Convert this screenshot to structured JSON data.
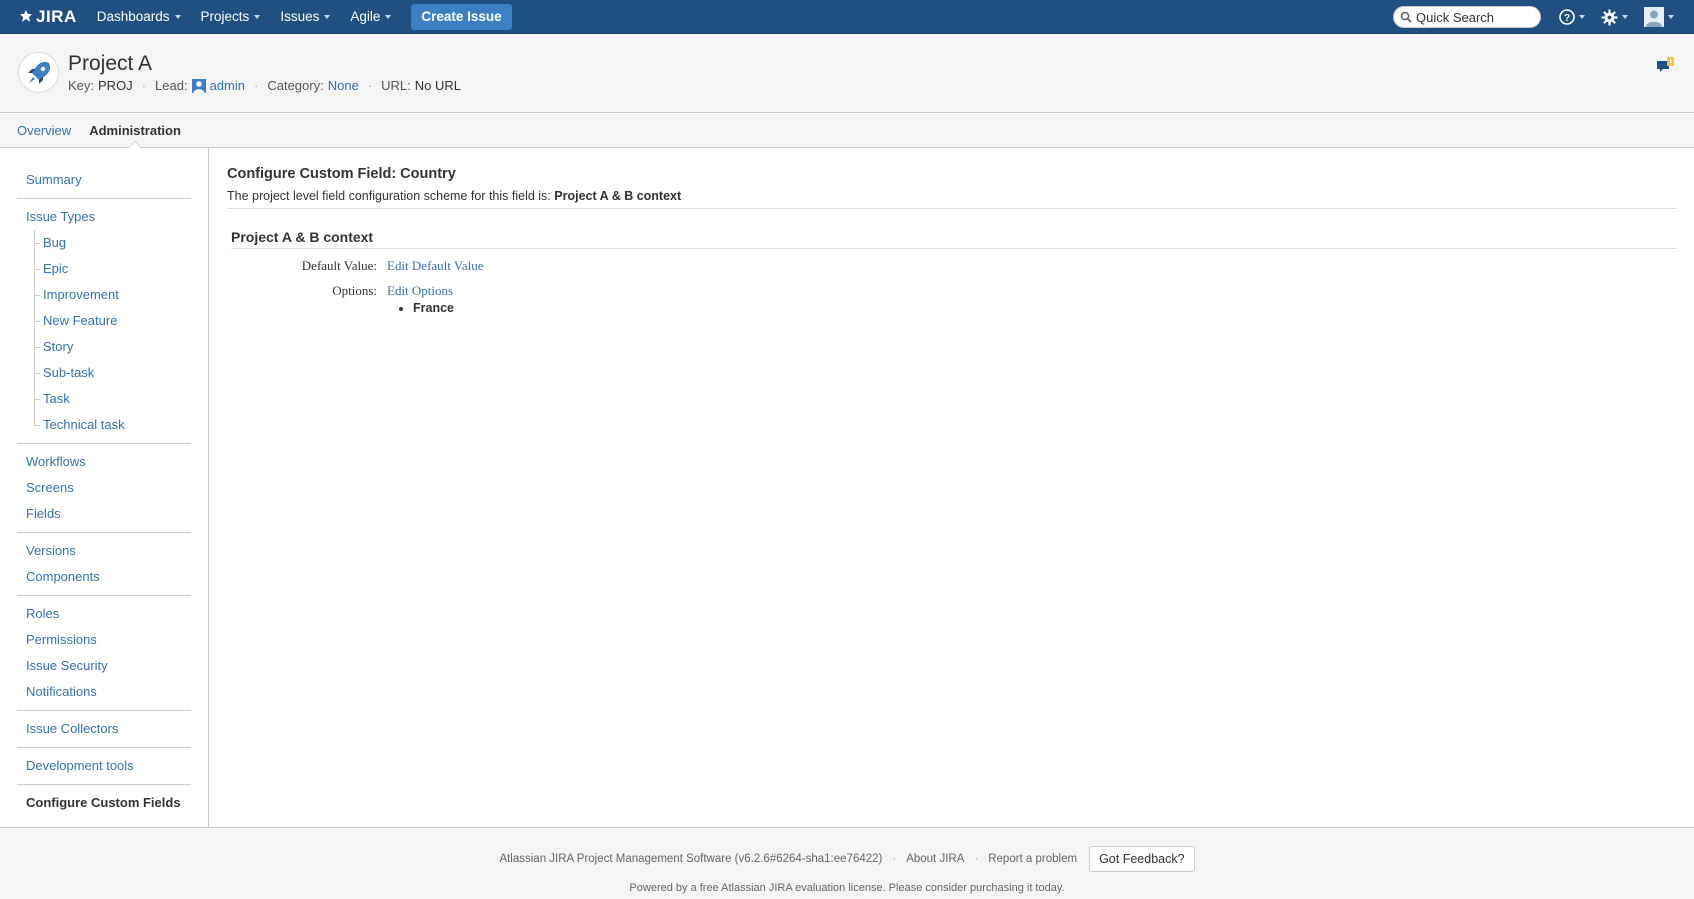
{
  "header": {
    "logo_text": "JIRA",
    "nav": [
      "Dashboards",
      "Projects",
      "Issues",
      "Agile"
    ],
    "create_label": "Create Issue",
    "search_placeholder": "Quick Search",
    "icons": [
      "help-icon",
      "gear-icon",
      "user-avatar-icon"
    ]
  },
  "project": {
    "name": "Project A",
    "key_label": "Key:",
    "key": "PROJ",
    "lead_label": "Lead:",
    "lead": "admin",
    "category_label": "Category:",
    "category": "None",
    "url_label": "URL:",
    "url": "No URL"
  },
  "tabs": [
    {
      "label": "Overview",
      "active": false
    },
    {
      "label": "Administration",
      "active": true
    }
  ],
  "sidebar": {
    "summary": "Summary",
    "issue_types": "Issue Types",
    "issue_type_items": [
      "Bug",
      "Epic",
      "Improvement",
      "New Feature",
      "Story",
      "Sub-task",
      "Task",
      "Technical task"
    ],
    "workflows": "Workflows",
    "screens": "Screens",
    "fields": "Fields",
    "versions": "Versions",
    "components": "Components",
    "roles": "Roles",
    "permissions": "Permissions",
    "issue_security": "Issue Security",
    "notifications": "Notifications",
    "issue_collectors": "Issue Collectors",
    "development_tools": "Development tools",
    "configure_custom_fields": "Configure Custom Fields"
  },
  "main": {
    "title": "Configure Custom Field: Country",
    "scheme_text": "The project level field configuration scheme for this field is:",
    "scheme_name": "Project A & B context",
    "context_title": "Project A & B context",
    "default_value_label": "Default Value:",
    "default_value_link": "Edit Default Value",
    "options_label": "Options:",
    "options_link": "Edit Options",
    "options": [
      "France"
    ]
  },
  "footer": {
    "software": "Atlassian JIRA Project Management Software (v6.2.6#6264-sha1:ee76422)",
    "about": "About JIRA",
    "report": "Report a problem",
    "feedback_button": "Got Feedback?",
    "license": "Powered by a free Atlassian JIRA evaluation license. Please consider purchasing it today."
  },
  "colors": {
    "header_bg": "#205081",
    "link": "#3572b0",
    "create_btn": "#3b7fc4",
    "feedback_badge": "#f6c342"
  }
}
